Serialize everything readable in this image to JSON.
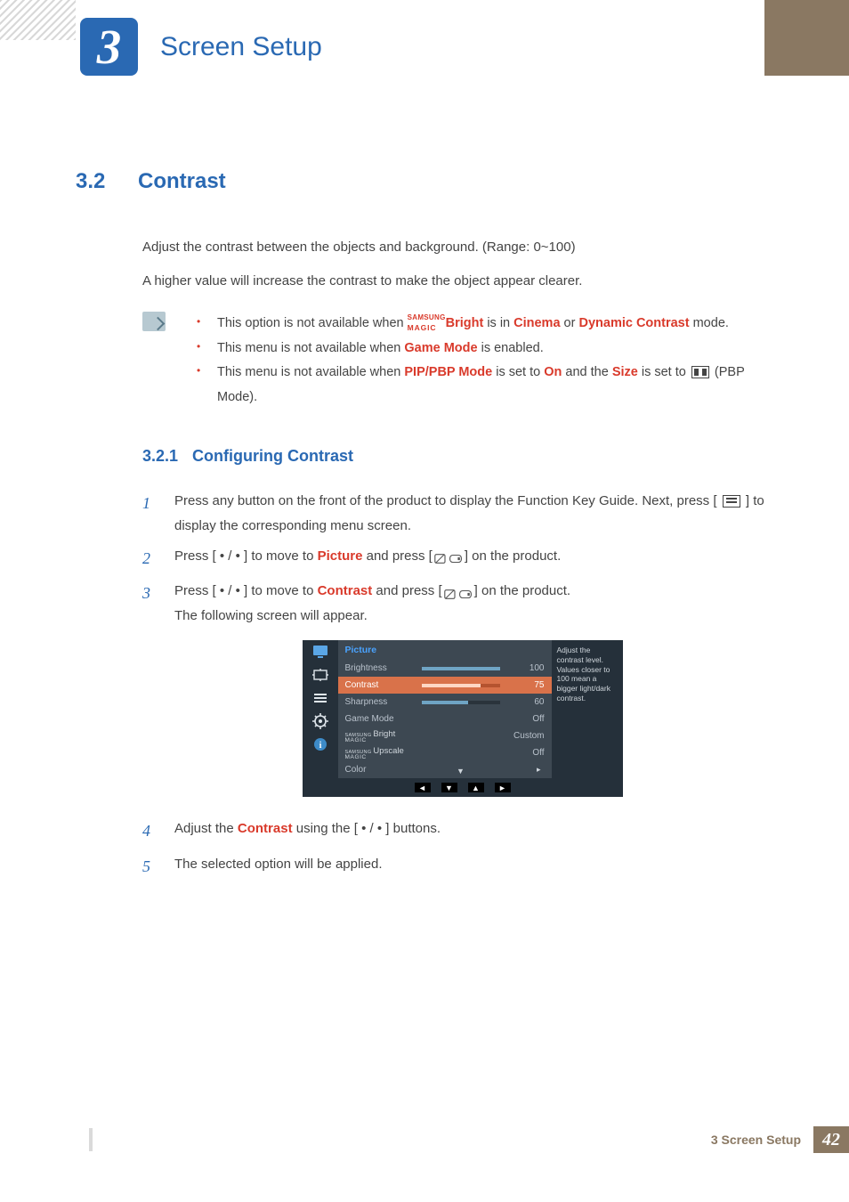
{
  "chapter": {
    "num": "3",
    "title": "Screen Setup"
  },
  "section": {
    "num": "3.2",
    "title": "Contrast"
  },
  "intro": {
    "p1": "Adjust the contrast between the objects and background. (Range: 0~100)",
    "p2": "A higher value will increase the contrast to make the object appear clearer."
  },
  "notes": {
    "n1_a": "This option is not available when ",
    "n1_magic_pre": "SAMSUNG",
    "n1_magic_sub": "MAGIC",
    "n1_bright": "Bright",
    "n1_b": " is in ",
    "n1_cinema": "Cinema",
    "n1_c": " or ",
    "n1_dyn": "Dynamic Contrast",
    "n1_d": " mode.",
    "n2_a": "This menu is not available when ",
    "n2_game": "Game Mode",
    "n2_b": " is enabled.",
    "n3_a": "This menu is not available when ",
    "n3_pip": "PIP/PBP Mode",
    "n3_b": " is set to ",
    "n3_on": "On",
    "n3_c": " and the ",
    "n3_size": "Size",
    "n3_d": " is set to ",
    "n3_e": " (PBP Mode)."
  },
  "subsection": {
    "num": "3.2.1",
    "title": "Configuring Contrast"
  },
  "steps": {
    "s1": "Press any button on the front of the product to display the Function Key Guide. Next, press [ ",
    "s1b": " ] to display the corresponding menu screen.",
    "s2a": "Press [ ",
    "s2dots": "• / •",
    "s2b": " ] to move to ",
    "s2pic": "Picture",
    "s2c": " and press [",
    "s2d": "] on the product.",
    "s3a": "Press [ ",
    "s3b": " ] to move to ",
    "s3con": "Contrast",
    "s3c": " and press [",
    "s3d": "] on the product.",
    "s3e": "The following screen will appear.",
    "s4a": "Adjust the ",
    "s4con": "Contrast",
    "s4b": " using the [ ",
    "s4c": " ] buttons.",
    "s5": "The selected option will be applied."
  },
  "osd": {
    "title": "Picture",
    "help": "Adjust the contrast level. Values closer to 100 mean a bigger light/dark contrast.",
    "rows": [
      {
        "label": "Brightness",
        "bar": 100,
        "val": "100"
      },
      {
        "label": "Contrast",
        "bar": 75,
        "val": "75"
      },
      {
        "label": "Sharpness",
        "bar": 60,
        "val": "60"
      },
      {
        "label": "Game Mode",
        "val": "Off"
      },
      {
        "label_pre": "SAMSUNG",
        "label_sub": "MAGIC",
        "label_after": "Bright",
        "val": "Custom"
      },
      {
        "label_pre": "SAMSUNG",
        "label_sub": "MAGIC",
        "label_after": "Upscale",
        "val": "Off"
      },
      {
        "label": "Color",
        "arrow": true
      }
    ]
  },
  "footer": {
    "text": "3 Screen Setup",
    "page": "42"
  }
}
